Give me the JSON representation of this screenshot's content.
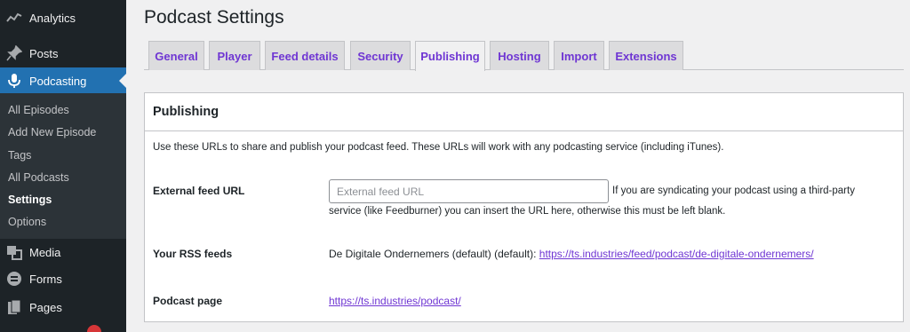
{
  "sidebar": {
    "items": [
      {
        "label": "Analytics",
        "icon": "chart-line-icon"
      },
      {
        "label": "Posts",
        "icon": "pushpin-icon"
      },
      {
        "label": "Podcasting",
        "icon": "microphone-icon",
        "active": true
      },
      {
        "label": "Media",
        "icon": "media-icon"
      },
      {
        "label": "Forms",
        "icon": "forms-icon"
      },
      {
        "label": "Pages",
        "icon": "pages-icon"
      }
    ],
    "submenu": [
      {
        "label": "All Episodes"
      },
      {
        "label": "Add New Episode"
      },
      {
        "label": "Tags"
      },
      {
        "label": "All Podcasts"
      },
      {
        "label": "Settings",
        "current": true
      },
      {
        "label": "Options"
      }
    ]
  },
  "page": {
    "title": "Podcast Settings"
  },
  "tabs": [
    {
      "label": "General"
    },
    {
      "label": "Player"
    },
    {
      "label": "Feed details"
    },
    {
      "label": "Security"
    },
    {
      "label": "Publishing",
      "active": true
    },
    {
      "label": "Hosting"
    },
    {
      "label": "Import"
    },
    {
      "label": "Extensions"
    }
  ],
  "panel": {
    "title": "Publishing",
    "intro": "Use these URLs to share and publish your podcast feed. These URLs will work with any podcasting service (including iTunes).",
    "external_feed": {
      "label": "External feed URL",
      "placeholder": "External feed URL",
      "value": "",
      "description_line1": "If you are syndicating your podcast using a third-party",
      "description_line2": "service (like Feedburner) you can insert the URL here, otherwise this must be left blank."
    },
    "rss": {
      "label": "Your RSS feeds",
      "prefix": "De Digitale Ondernemers (default) (default):",
      "url": "https://ts.industries/feed/podcast/de-digitale-ondernemers/"
    },
    "podcast_page": {
      "label": "Podcast page",
      "url": "https://ts.industries/podcast/"
    }
  },
  "colors": {
    "sidebar_bg": "#1d2327",
    "submenu_bg": "#2c3338",
    "accent_blue": "#2271b1",
    "link_purple": "#6f36d3",
    "badge_red": "#d63638"
  }
}
